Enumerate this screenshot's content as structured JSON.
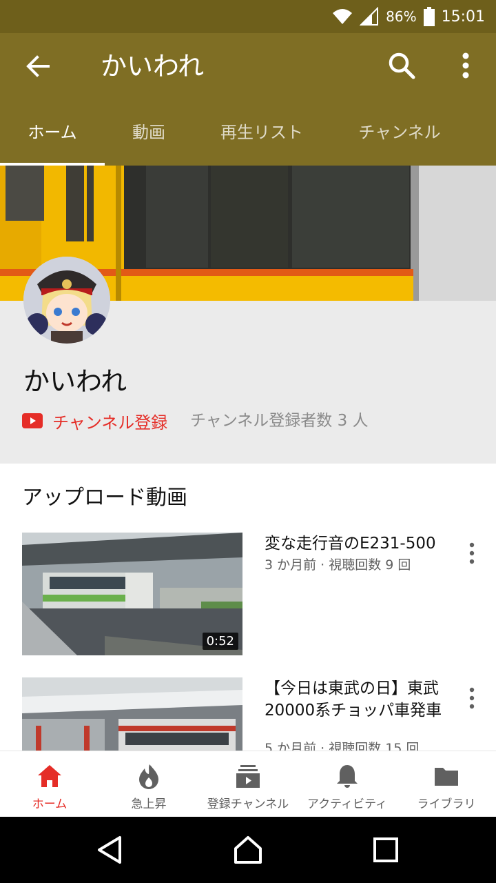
{
  "status_bar": {
    "battery": "86%",
    "time": "15:01"
  },
  "app_bar": {
    "title": "かいわれ"
  },
  "tabs": [
    {
      "label": "ホーム"
    },
    {
      "label": "動画"
    },
    {
      "label": "再生リスト"
    },
    {
      "label": "チャンネル"
    }
  ],
  "channel": {
    "name": "かいわれ",
    "subscribe_label": "チャンネル登録",
    "subscriber_count": "チャンネル登録者数 3 人"
  },
  "section": {
    "title": "アップロード動画"
  },
  "videos": [
    {
      "title": "変な走行音のE231-500",
      "meta": "3 か月前 · 視聴回数 9 回",
      "duration": "0:52"
    },
    {
      "title": "【今日は東武の日】東武20000系チョッパ車発車",
      "meta": "5 か月前 · 視聴回数 15 回",
      "duration": ""
    }
  ],
  "bottom_nav": [
    {
      "label": "ホーム",
      "icon": "home-icon"
    },
    {
      "label": "急上昇",
      "icon": "trending-flame-icon"
    },
    {
      "label": "登録チャンネル",
      "icon": "subscriptions-icon"
    },
    {
      "label": "アクティビティ",
      "icon": "bell-icon"
    },
    {
      "label": "ライブラリ",
      "icon": "folder-icon"
    }
  ],
  "colors": {
    "app_bar": "#7f6e24",
    "status_bar": "#6e5f1b",
    "accent_red": "#e52d27",
    "header_bg": "#ebebeb"
  }
}
